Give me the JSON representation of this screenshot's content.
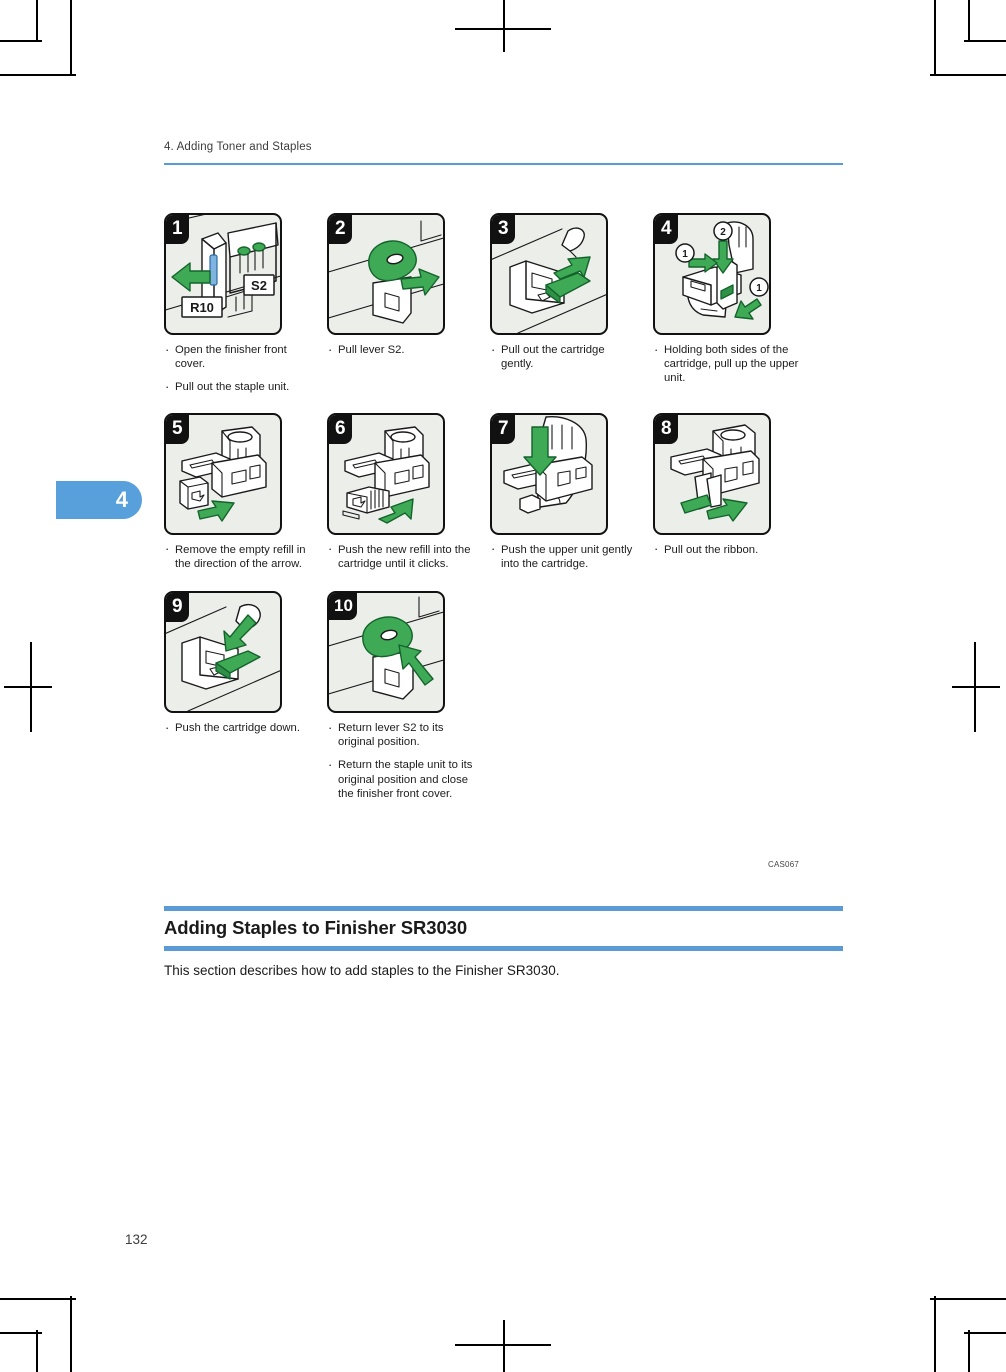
{
  "page": {
    "running_head": "4. Adding Toner and Staples",
    "chapter_tab": "4",
    "page_number": "132",
    "figure_code": "CAS067",
    "accent_color": "#5b9bd5"
  },
  "steps": [
    {
      "number": "1",
      "image_labels": [
        "R10",
        "S2"
      ],
      "captions": [
        "Open the finisher front cover.",
        "Pull out the staple unit."
      ]
    },
    {
      "number": "2",
      "image_labels": [],
      "captions": [
        "Pull lever S2."
      ]
    },
    {
      "number": "3",
      "image_labels": [],
      "captions": [
        "Pull out the cartridge gently."
      ]
    },
    {
      "number": "4",
      "image_labels": [
        "1",
        "2",
        "1"
      ],
      "captions": [
        "Holding both sides of the cartridge, pull up the upper unit."
      ]
    },
    {
      "number": "5",
      "image_labels": [],
      "captions": [
        "Remove the empty refill in the direction of the arrow."
      ]
    },
    {
      "number": "6",
      "image_labels": [],
      "captions": [
        "Push the new refill into the cartridge until it clicks."
      ]
    },
    {
      "number": "7",
      "image_labels": [],
      "captions": [
        "Push the upper unit gently into the cartridge."
      ]
    },
    {
      "number": "8",
      "image_labels": [],
      "captions": [
        "Pull out the ribbon."
      ]
    },
    {
      "number": "9",
      "image_labels": [],
      "captions": [
        "Push the cartridge down."
      ]
    },
    {
      "number": "10",
      "image_labels": [],
      "captions": [
        "Return lever S2 to its original position.",
        "Return the staple unit to its original position and close the finisher front cover."
      ]
    }
  ],
  "section": {
    "heading": "Adding Staples to Finisher SR3030",
    "body": "This section describes how to add staples to the Finisher SR3030."
  }
}
